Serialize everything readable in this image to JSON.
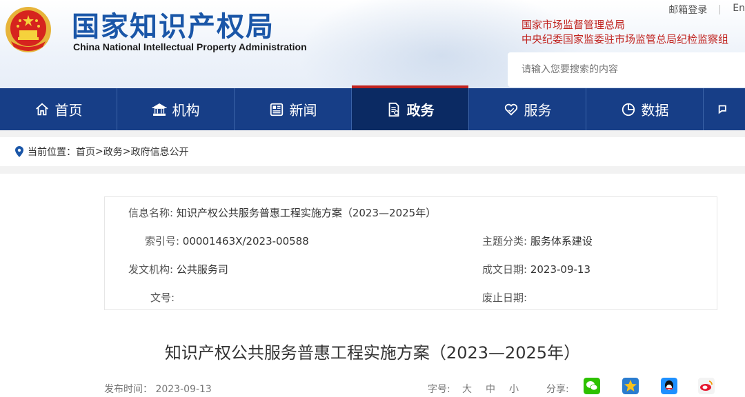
{
  "header": {
    "title_cn": "国家知识产权局",
    "title_en": "China National Intellectual Property Administration",
    "login_label": "邮箱登录",
    "lang_label": "En",
    "org_line1": "国家市场监督管理总局",
    "org_line2": "中央纪委国家监委驻市场监管总局纪检监察组",
    "search_placeholder": "请输入您要搜索的内容"
  },
  "nav": {
    "items": [
      {
        "label": "首页",
        "icon": "home-icon"
      },
      {
        "label": "机构",
        "icon": "building-icon"
      },
      {
        "label": "新闻",
        "icon": "newspaper-icon"
      },
      {
        "label": "政务",
        "icon": "document-icon",
        "active": true
      },
      {
        "label": "服务",
        "icon": "heart-hand-icon"
      },
      {
        "label": "数据",
        "icon": "pie-chart-icon"
      }
    ]
  },
  "breadcrumb": {
    "prefix": "当前位置：",
    "items": [
      "首页",
      ">",
      "政务",
      ">",
      "政府信息公开"
    ]
  },
  "info": {
    "name_label": "信息名称:",
    "name_value": "知识产权公共服务普惠工程实施方案（2023—2025年）",
    "index_label": "索引号:",
    "index_value": "00001463X/2023-00588",
    "topic_label": "主题分类:",
    "topic_value": "服务体系建设",
    "org_label": "发文机构:",
    "org_value": "公共服务司",
    "date_label": "成文日期:",
    "date_value": "2023-09-13",
    "docno_label": "文号:",
    "docno_value": "",
    "expire_label": "废止日期:",
    "expire_value": ""
  },
  "doc": {
    "title": "知识产权公共服务普惠工程实施方案（2023—2025年）",
    "publish_label": "发布时间：",
    "publish_value": "2023-09-13",
    "font_label": "字号:",
    "font_large": "大",
    "font_medium": "中",
    "font_small": "小",
    "share_label": "分享:"
  },
  "colors": {
    "brand_blue": "#1a56a8",
    "nav_blue": "#173e87",
    "nav_active": "#0b2a63",
    "accent_red": "#c0221e"
  }
}
